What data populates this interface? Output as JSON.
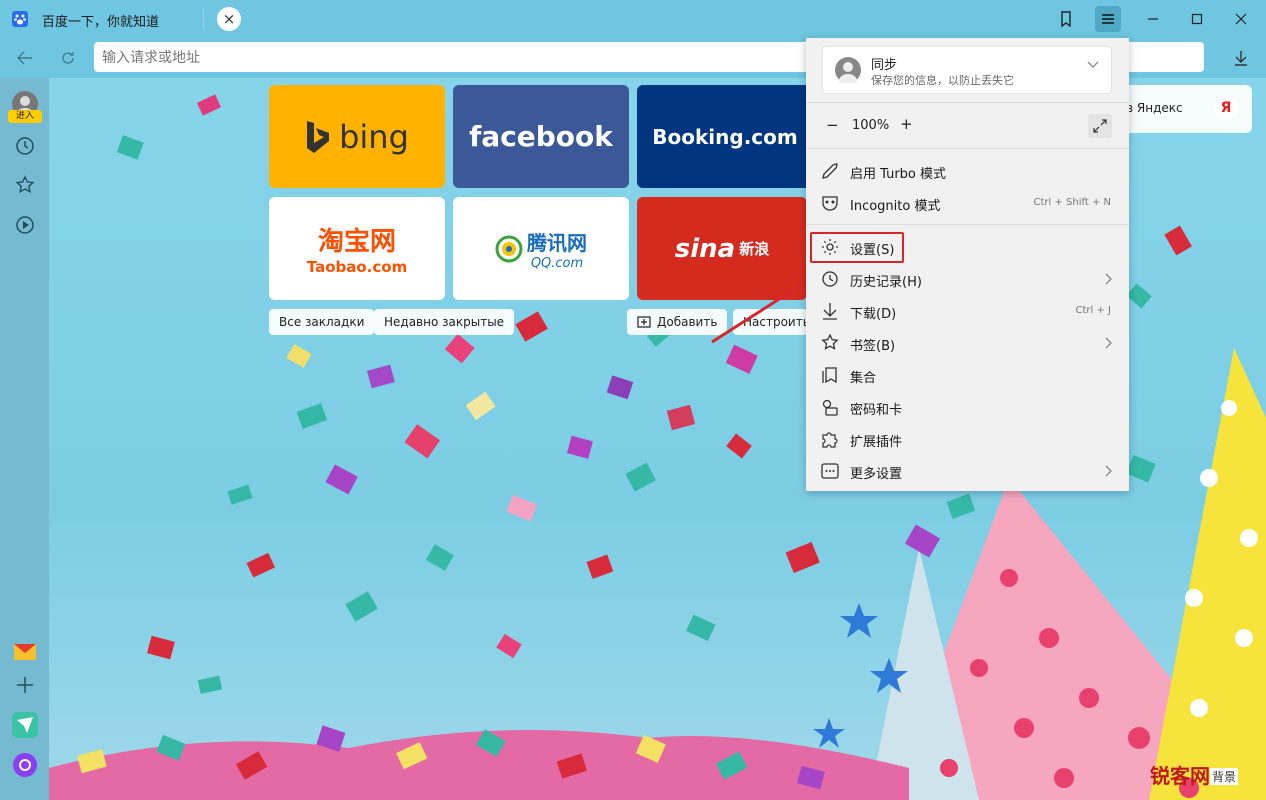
{
  "tab": {
    "title": "百度一下，你就知道",
    "close": "×"
  },
  "address": {
    "placeholder": "输入请求或地址"
  },
  "sidebar": {
    "enter_label": "进入"
  },
  "tiles": [
    {
      "label": "bing",
      "bg": "#ffb300",
      "color": "#333333"
    },
    {
      "label": "facebook",
      "bg": "#3b5998",
      "color": "#ffffff"
    },
    {
      "label": "Booking.com",
      "bg": "#003580",
      "color": "#ffffff"
    },
    {
      "label": "淘宝网",
      "sub": "Taobao.com",
      "bg": "#ffffff",
      "color": "#ff5000"
    },
    {
      "label": "腾讯网",
      "sub": "QQ.com",
      "bg": "#ffffff",
      "color": "#1a6dbd"
    },
    {
      "label": "sina",
      "sub": "新浪",
      "bg": "#d52b1e",
      "color": "#ffffff"
    }
  ],
  "chips": {
    "all_bookmarks": "Все закладки",
    "recently_closed": "Недавно закрытые",
    "add": "Добавить",
    "customize": "Настроить"
  },
  "yandex": {
    "text": "в Яндекс",
    "logo": "Я"
  },
  "menu": {
    "sync_title": "同步",
    "sync_sub": "保存您的信息，以防止丢失它",
    "zoom_minus": "−",
    "zoom_value": "100%",
    "zoom_plus": "+",
    "items": [
      {
        "label": "启用 Turbo 模式",
        "shortcut": ""
      },
      {
        "label": "Incognito 模式",
        "shortcut": "Ctrl + Shift + N"
      },
      {
        "label": "设置(S)",
        "shortcut": ""
      },
      {
        "label": "历史记录(H)",
        "shortcut": ""
      },
      {
        "label": "下载(D)",
        "shortcut": "Ctrl + J"
      },
      {
        "label": "书签(B)",
        "shortcut": ""
      },
      {
        "label": "集合",
        "shortcut": ""
      },
      {
        "label": "密码和卡",
        "shortcut": ""
      },
      {
        "label": "扩展插件",
        "shortcut": ""
      },
      {
        "label": "更多设置",
        "shortcut": ""
      }
    ]
  },
  "watermark": {
    "text": "锐客网",
    "sub": "背景"
  },
  "colors": {
    "accent": "#d6262c",
    "titlebar": "#6ec6e0"
  }
}
